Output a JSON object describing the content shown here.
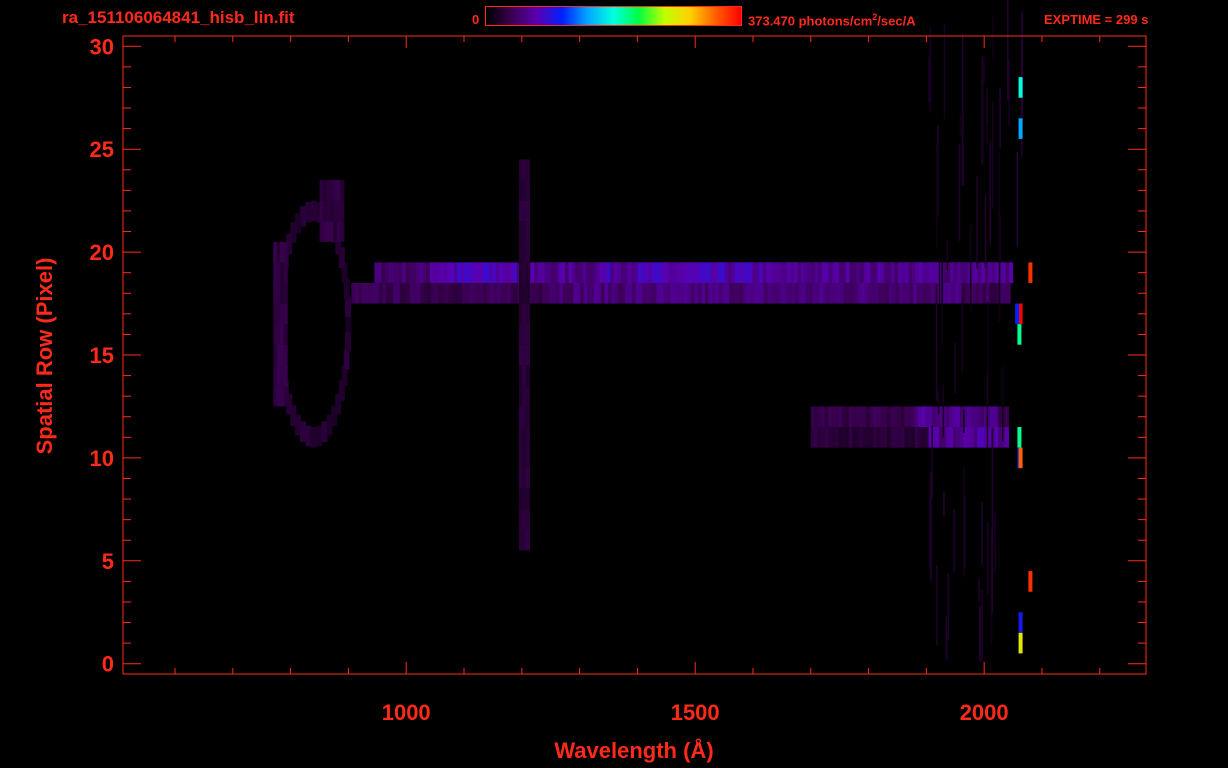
{
  "header": {
    "file_title": "ra_151106064841_hisb_lin.fit",
    "colorbar_min": "0",
    "colorbar_max_prefix": "373.470 photons/cm",
    "colorbar_max_sup": "2",
    "colorbar_max_suffix": "/sec/A",
    "exptime": "EXPTIME = 299 s"
  },
  "colors": {
    "axis": "#ff2a1a",
    "background": "#000000",
    "colormap": [
      "#000000",
      "#3a0050",
      "#5a00b0",
      "#0020ff",
      "#00a8ff",
      "#00ffe0",
      "#00ff40",
      "#c0ff00",
      "#ffd000",
      "#ff6000",
      "#ff0000"
    ]
  },
  "chart_data": {
    "type": "heatmap",
    "title": "ra_151106064841_hisb_lin.fit",
    "xlabel": "Wavelength (Å)",
    "ylabel": "Spatial Row (Pixel)",
    "xlim": [
      510,
      2280
    ],
    "ylim": [
      -0.5,
      30.5
    ],
    "x_ticks": [
      1000,
      1500,
      2000
    ],
    "y_ticks": [
      0,
      5,
      10,
      15,
      20,
      25,
      30
    ],
    "colorbar": {
      "min": 0,
      "max": 373.47,
      "units": "photons/cm²/sec/A"
    },
    "grid": false,
    "bands": [
      {
        "x": [
          945,
          2045
        ],
        "rows": [
          19,
          19
        ],
        "level": 0.13,
        "hi_x": [
          1040,
          1190
        ],
        "hi_level": 0.2
      },
      {
        "x": [
          1215,
          2045
        ],
        "rows": [
          19,
          19
        ],
        "level": 0.16,
        "hi_x": [
          1330,
          1620
        ],
        "hi_level": 0.19
      },
      {
        "x": [
          905,
          2040
        ],
        "rows": [
          18,
          18
        ],
        "level": 0.1,
        "hi_x": [
          1230,
          1960
        ],
        "hi_level": 0.14
      },
      {
        "x": [
          1700,
          2040
        ],
        "rows": [
          12,
          12
        ],
        "level": 0.09,
        "hi_x": [
          1880,
          2020
        ],
        "hi_level": 0.16
      },
      {
        "x": [
          1700,
          2040
        ],
        "rows": [
          11,
          11
        ],
        "level": 0.07,
        "hi_x": [
          1900,
          2050
        ],
        "hi_level": 0.17
      },
      {
        "x": [
          1195,
          1210
        ],
        "rows": [
          6,
          24
        ],
        "level": 0.07,
        "hi_x": [
          1195,
          1210
        ],
        "hi_level": 0.07
      },
      {
        "x": [
          770,
          790
        ],
        "rows": [
          13,
          20
        ],
        "level": 0.08,
        "hi_x": [
          770,
          790
        ],
        "hi_level": 0.08
      },
      {
        "x": [
          850,
          890
        ],
        "rows": [
          21,
          23
        ],
        "level": 0.08,
        "hi_x": [
          850,
          890
        ],
        "hi_level": 0.08
      }
    ],
    "ring": {
      "cx": 840,
      "cy": 16.5,
      "rx": 60,
      "ry": 5.5,
      "level": 0.06
    },
    "right_edge_pixels": [
      {
        "x": 2063,
        "row": 28,
        "level": 0.5
      },
      {
        "x": 2063,
        "row": 26,
        "level": 0.4
      },
      {
        "x": 2063,
        "row": 17,
        "level": 1.0
      },
      {
        "x": 2057,
        "row": 17,
        "level": 0.3
      },
      {
        "x": 2061,
        "row": 16,
        "level": 0.55
      },
      {
        "x": 2061,
        "row": 11,
        "level": 0.55
      },
      {
        "x": 2061,
        "row": 10,
        "level": 0.3
      },
      {
        "x": 2063,
        "row": 10,
        "level": 0.9
      },
      {
        "x": 2063,
        "row": 2,
        "level": 0.28
      },
      {
        "x": 2063,
        "row": 1,
        "level": 0.75
      },
      {
        "x": 2080,
        "row": 19,
        "level": 0.95
      },
      {
        "x": 2080,
        "row": 4,
        "level": 0.95
      }
    ]
  }
}
